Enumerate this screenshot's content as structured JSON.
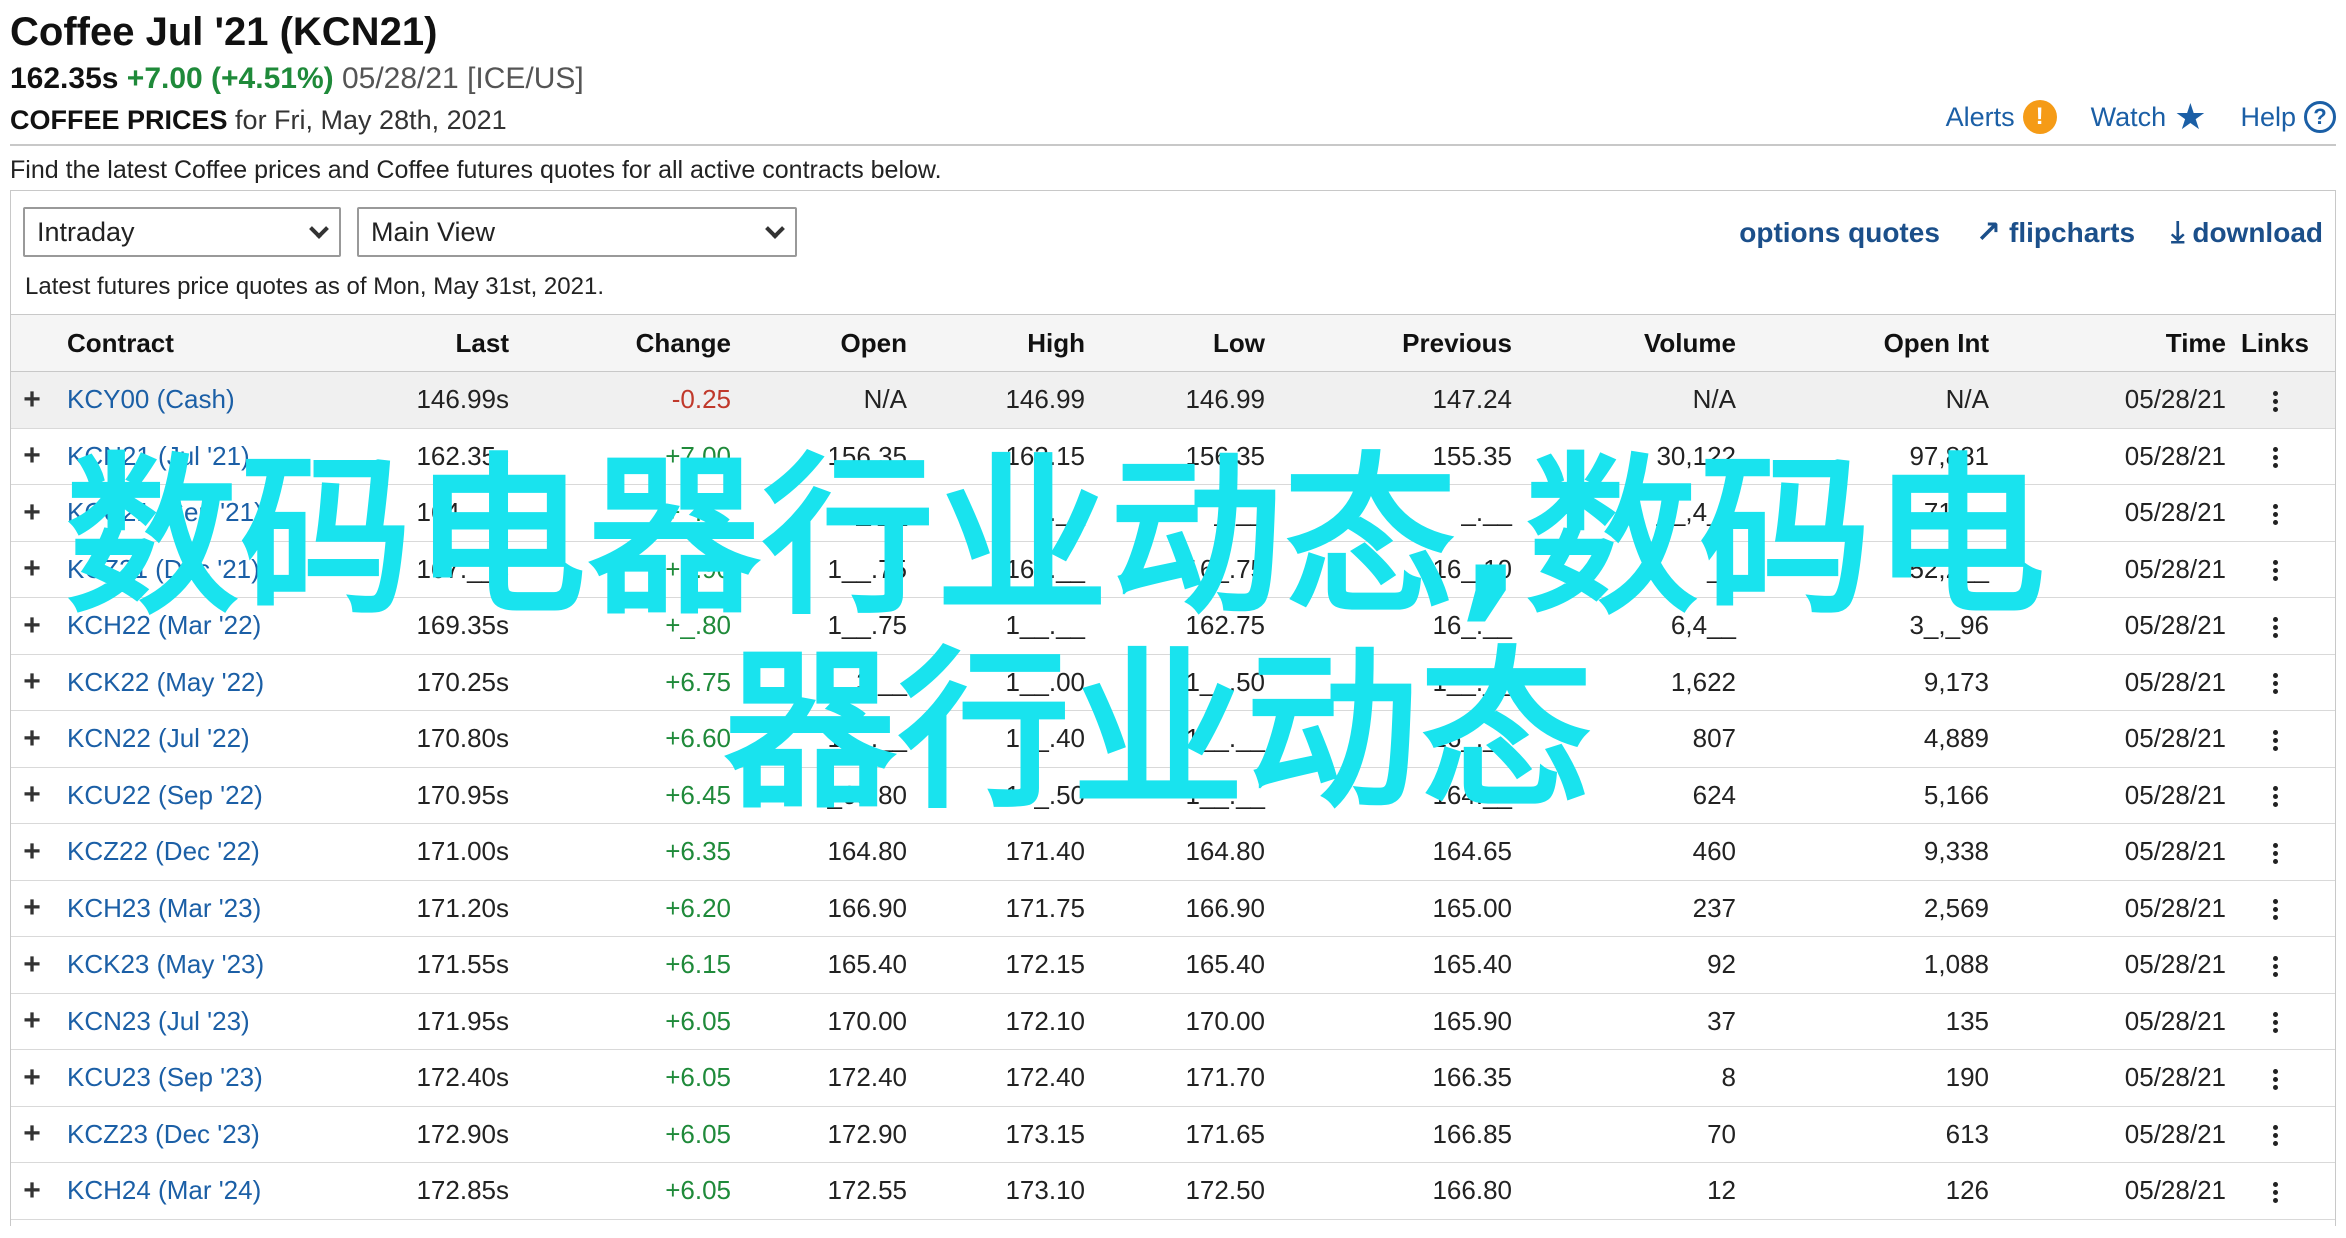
{
  "header": {
    "title": "Coffee Jul '21 (KCN21)",
    "price": "162.35s",
    "change": "+7.00 (+4.51%)",
    "meta": "05/28/21 [ICE/US]",
    "prices_label": "COFFEE PRICES",
    "prices_date": "for Fri, May 28th, 2021"
  },
  "top_links": {
    "alerts": "Alerts",
    "alerts_icon": "!",
    "watch": "Watch",
    "watch_icon": "★",
    "help": "Help",
    "help_icon": "?"
  },
  "intro": "Find the latest Coffee prices and Coffee futures quotes for all active contracts below.",
  "controls": {
    "period": "Intraday",
    "view": "Main View"
  },
  "actions": {
    "options": "options quotes",
    "flipcharts": "flipcharts",
    "flipcharts_icon": "↗",
    "download": "download",
    "download_icon": "⤓"
  },
  "asof": "Latest futures price quotes as of Mon, May 31st, 2021.",
  "columns": {
    "contract": "Contract",
    "last": "Last",
    "change": "Change",
    "open": "Open",
    "high": "High",
    "low": "Low",
    "previous": "Previous",
    "volume": "Volume",
    "open_int": "Open Int",
    "time": "Time",
    "links": "Links"
  },
  "rows": [
    {
      "contract": "KCY00 (Cash)",
      "last": "146.99s",
      "change": "-0.25",
      "open": "N/A",
      "high": "146.99",
      "low": "146.99",
      "previous": "147.24",
      "volume": "N/A",
      "open_int": "N/A",
      "time": "05/28/21",
      "dir": "neg"
    },
    {
      "contract": "KCN21 (Jul '21)",
      "last": "162.35s",
      "change": "+7.00",
      "open": "156.35",
      "high": "163.15",
      "low": "156.35",
      "previous": "155.35",
      "volume": "30,122",
      "open_int": "97,881",
      "time": "05/28/21",
      "dir": "pos"
    },
    {
      "contract": "KCU21 (Sep '21)",
      "last": "164.__s",
      "change": "+_.__",
      "open": "_.__",
      "high": "_.__",
      "low": "_.__",
      "previous": "_.__",
      "volume": "__,4__",
      "open_int": "71,__",
      "time": "05/28/21",
      "dir": "pos"
    },
    {
      "contract": "KCZ21 (Dec '21)",
      "last": "167.__s",
      "change": "+6.90",
      "open": "1__.75",
      "high": "16_.__",
      "low": "16_.75",
      "previous": "16_.10",
      "volume": "__",
      "open_int": "52,2__",
      "time": "05/28/21",
      "dir": "pos"
    },
    {
      "contract": "KCH22 (Mar '22)",
      "last": "169.35s",
      "change": "+_.80",
      "open": "1__.75",
      "high": "1__.__",
      "low": "162.75",
      "previous": "16_.__",
      "volume": "6,4__",
      "open_int": "3_,_96",
      "time": "05/28/21",
      "dir": "pos"
    },
    {
      "contract": "KCK22 (May '22)",
      "last": "170.25s",
      "change": "+6.75",
      "open": "__3.__",
      "high": "1__.00",
      "low": "1__.50",
      "previous": "1__.__",
      "volume": "1,622",
      "open_int": "9,173",
      "time": "05/28/21",
      "dir": "pos"
    },
    {
      "contract": "KCN22 (Jul '22)",
      "last": "170.80s",
      "change": "+6.60",
      "open": "1__.__",
      "high": "17_.40",
      "low": "1__.__",
      "previous": "16_.__",
      "volume": "807",
      "open_int": "4,889",
      "time": "05/28/21",
      "dir": "pos"
    },
    {
      "contract": "KCU22 (Sep '22)",
      "last": "170.95s",
      "change": "+6.45",
      "open": "_68.80",
      "high": "17_.50",
      "low": "1__.__",
      "previous": "164.__",
      "volume": "624",
      "open_int": "5,166",
      "time": "05/28/21",
      "dir": "pos"
    },
    {
      "contract": "KCZ22 (Dec '22)",
      "last": "171.00s",
      "change": "+6.35",
      "open": "164.80",
      "high": "171.40",
      "low": "164.80",
      "previous": "164.65",
      "volume": "460",
      "open_int": "9,338",
      "time": "05/28/21",
      "dir": "pos"
    },
    {
      "contract": "KCH23 (Mar '23)",
      "last": "171.20s",
      "change": "+6.20",
      "open": "166.90",
      "high": "171.75",
      "low": "166.90",
      "previous": "165.00",
      "volume": "237",
      "open_int": "2,569",
      "time": "05/28/21",
      "dir": "pos"
    },
    {
      "contract": "KCK23 (May '23)",
      "last": "171.55s",
      "change": "+6.15",
      "open": "165.40",
      "high": "172.15",
      "low": "165.40",
      "previous": "165.40",
      "volume": "92",
      "open_int": "1,088",
      "time": "05/28/21",
      "dir": "pos"
    },
    {
      "contract": "KCN23 (Jul '23)",
      "last": "171.95s",
      "change": "+6.05",
      "open": "170.00",
      "high": "172.10",
      "low": "170.00",
      "previous": "165.90",
      "volume": "37",
      "open_int": "135",
      "time": "05/28/21",
      "dir": "pos"
    },
    {
      "contract": "KCU23 (Sep '23)",
      "last": "172.40s",
      "change": "+6.05",
      "open": "172.40",
      "high": "172.40",
      "low": "171.70",
      "previous": "166.35",
      "volume": "8",
      "open_int": "190",
      "time": "05/28/21",
      "dir": "pos"
    },
    {
      "contract": "KCZ23 (Dec '23)",
      "last": "172.90s",
      "change": "+6.05",
      "open": "172.90",
      "high": "173.15",
      "low": "171.65",
      "previous": "166.85",
      "volume": "70",
      "open_int": "613",
      "time": "05/28/21",
      "dir": "pos"
    },
    {
      "contract": "KCH24 (Mar '24)",
      "last": "172.85s",
      "change": "+6.05",
      "open": "172.55",
      "high": "173.10",
      "low": "172.50",
      "previous": "166.80",
      "volume": "12",
      "open_int": "126",
      "time": "05/28/21",
      "dir": "pos"
    }
  ],
  "watermark": {
    "line1": "数码电器行业动态,数码电",
    "line2": "器行业动态",
    "color": "#19e3ee"
  },
  "colors": {
    "link": "#1b5fa6",
    "positive": "#1f8a3a",
    "negative": "#c0392b",
    "alert": "#f59b16"
  }
}
